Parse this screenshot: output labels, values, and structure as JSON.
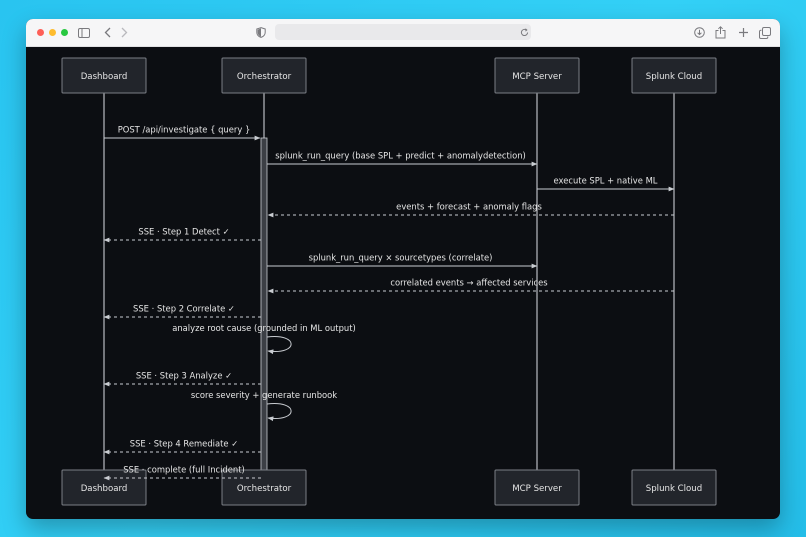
{
  "browser": {
    "icons": [
      "sidebar-icon",
      "back-icon",
      "forward-icon",
      "shield-icon",
      "reload-icon",
      "download-icon",
      "share-icon",
      "new-tab-icon",
      "tabs-overview-icon"
    ]
  },
  "diagram": {
    "type": "sequence",
    "colors": {
      "background": "#0c0e12",
      "actor_fill": "#22252b",
      "actor_stroke": "#7b7f86",
      "line": "#c9ccd1",
      "text": "#e6e6e6"
    },
    "participants": [
      {
        "id": "dashboard",
        "label": "Dashboard"
      },
      {
        "id": "orchestrator",
        "label": "Orchestrator"
      },
      {
        "id": "mcp",
        "label": "MCP Server"
      },
      {
        "id": "splunk",
        "label": "Splunk Cloud"
      }
    ],
    "messages": [
      {
        "from": "dashboard",
        "to": "orchestrator",
        "label": "POST /api/investigate { query }",
        "style": "solid"
      },
      {
        "from": "orchestrator",
        "to": "mcp",
        "label": "splunk_run_query (base SPL + predict + anomalydetection)",
        "style": "solid"
      },
      {
        "from": "mcp",
        "to": "splunk",
        "label": "execute SPL + native ML",
        "style": "solid"
      },
      {
        "from": "splunk",
        "to": "orchestrator",
        "label": "events + forecast + anomaly flags",
        "style": "dashed"
      },
      {
        "from": "orchestrator",
        "to": "dashboard",
        "label": "SSE · Step 1 Detect ✓",
        "style": "dashed"
      },
      {
        "from": "orchestrator",
        "to": "mcp",
        "label": "splunk_run_query × sourcetypes (correlate)",
        "style": "solid"
      },
      {
        "from": "splunk",
        "to": "orchestrator",
        "label": "correlated events → affected services",
        "style": "dashed"
      },
      {
        "from": "orchestrator",
        "to": "dashboard",
        "label": "SSE · Step 2 Correlate ✓",
        "style": "dashed"
      },
      {
        "from": "orchestrator",
        "to": "orchestrator",
        "label": "analyze root cause (grounded in ML output)",
        "style": "self"
      },
      {
        "from": "orchestrator",
        "to": "dashboard",
        "label": "SSE · Step 3 Analyze ✓",
        "style": "dashed"
      },
      {
        "from": "orchestrator",
        "to": "orchestrator",
        "label": "score severity + generate runbook",
        "style": "self"
      },
      {
        "from": "orchestrator",
        "to": "dashboard",
        "label": "SSE · Step 4 Remediate ✓",
        "style": "dashed"
      },
      {
        "from": "orchestrator",
        "to": "dashboard",
        "label": "SSE · complete (full Incident)",
        "style": "dashed"
      }
    ]
  }
}
